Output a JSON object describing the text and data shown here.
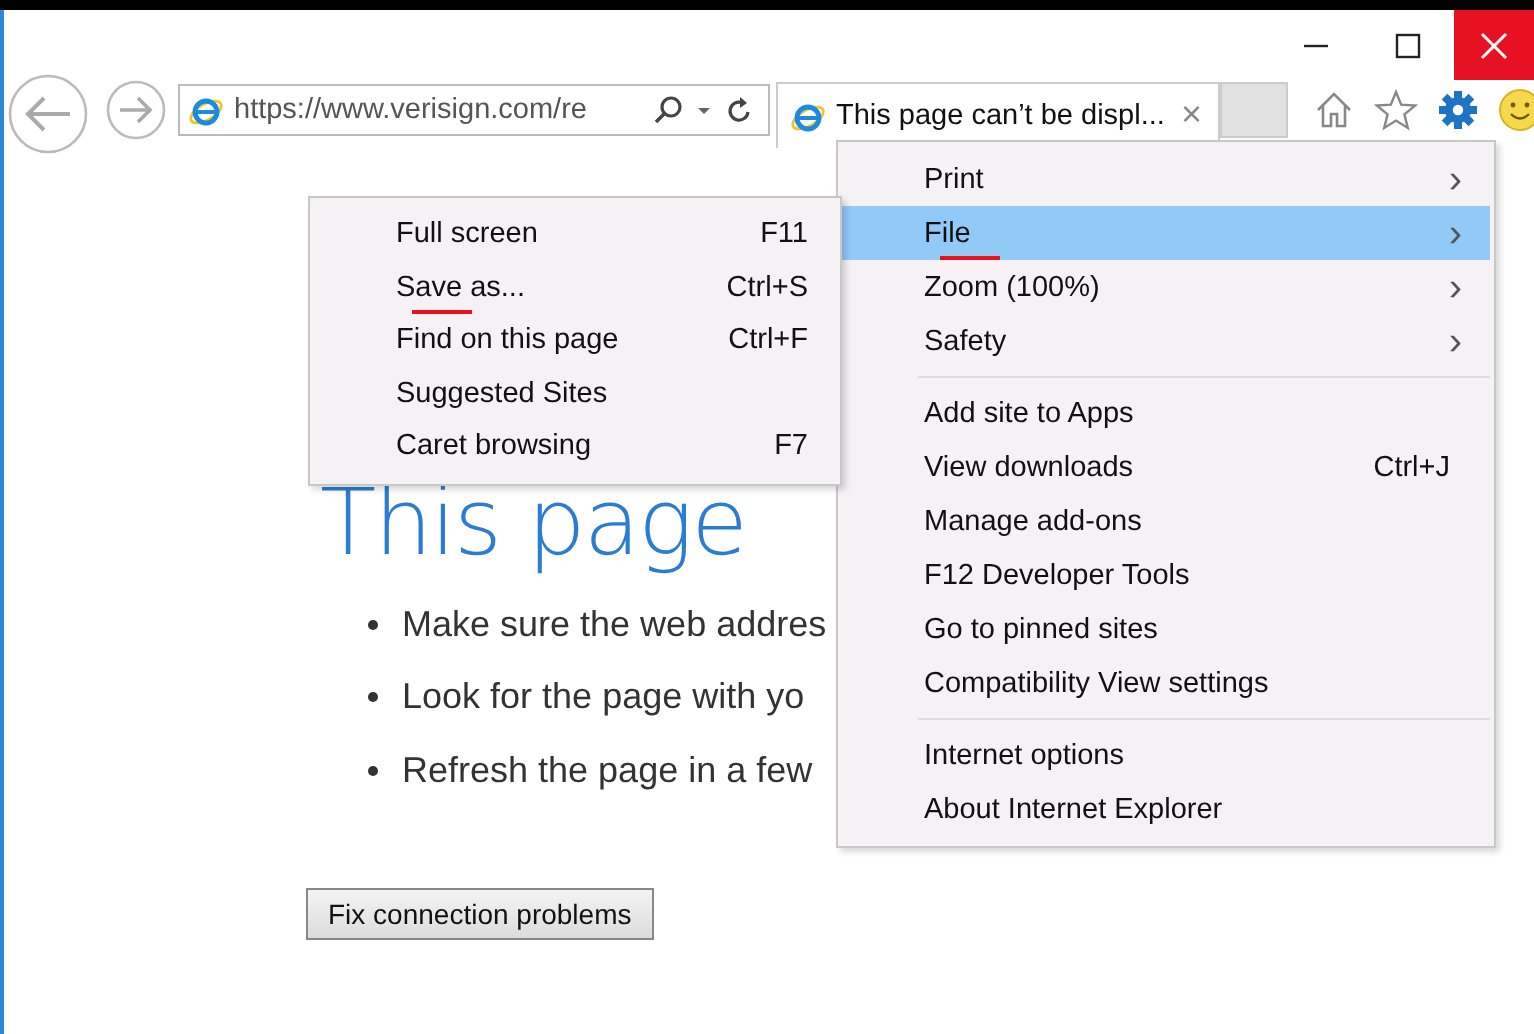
{
  "window": {
    "controls": [
      {
        "kind": "minimize"
      },
      {
        "kind": "maximize"
      },
      {
        "kind": "close"
      }
    ]
  },
  "toolbar": {
    "address": "https://www.verisign.com/re",
    "tab": {
      "title": "This page can’t be displ...",
      "close": "×"
    }
  },
  "page": {
    "heading": "This page",
    "bullets": [
      "Make sure the web addres",
      "Look for the page with yo",
      "Refresh the page in a few"
    ],
    "button": "Fix connection problems"
  },
  "tools_menu": {
    "items": [
      {
        "kind": "item",
        "label": "Print",
        "submenu_arrow": "›",
        "selected": false,
        "underlined": false
      },
      {
        "kind": "item",
        "label": "File",
        "submenu_arrow": "›",
        "selected": true,
        "underlined": true
      },
      {
        "kind": "item",
        "label": "Zoom (100%)",
        "submenu_arrow": "›",
        "selected": false,
        "underlined": false
      },
      {
        "kind": "item",
        "label": "Safety",
        "submenu_arrow": "›",
        "selected": false,
        "underlined": false
      },
      {
        "kind": "separator"
      },
      {
        "kind": "item",
        "label": "Add site to Apps",
        "selected": false,
        "underlined": false
      },
      {
        "kind": "item",
        "label": "View downloads",
        "shortcut": "Ctrl+J",
        "selected": false,
        "underlined": false
      },
      {
        "kind": "item",
        "label": "Manage add-ons",
        "selected": false,
        "underlined": false
      },
      {
        "kind": "item",
        "label": "F12 Developer Tools",
        "selected": false,
        "underlined": false
      },
      {
        "kind": "item",
        "label": "Go to pinned sites",
        "selected": false,
        "underlined": false
      },
      {
        "kind": "item",
        "label": "Compatibility View settings",
        "selected": false,
        "underlined": false
      },
      {
        "kind": "separator"
      },
      {
        "kind": "item",
        "label": "Internet options",
        "selected": false,
        "underlined": false
      },
      {
        "kind": "item",
        "label": "About Internet Explorer",
        "selected": false,
        "underlined": false
      }
    ]
  },
  "file_submenu": {
    "items": [
      {
        "kind": "item",
        "label": "Full screen",
        "shortcut": "F11",
        "selected": false,
        "underlined": false
      },
      {
        "kind": "item",
        "label": "Save as...",
        "shortcut": "Ctrl+S",
        "selected": false,
        "underlined": true
      },
      {
        "kind": "item",
        "label": "Find on this page",
        "shortcut": "Ctrl+F",
        "selected": false,
        "underlined": false
      },
      {
        "kind": "item",
        "label": "Suggested Sites",
        "selected": false,
        "underlined": false
      },
      {
        "kind": "item",
        "label": "Caret browsing",
        "shortcut": "F7",
        "selected": false,
        "underlined": false
      }
    ]
  }
}
